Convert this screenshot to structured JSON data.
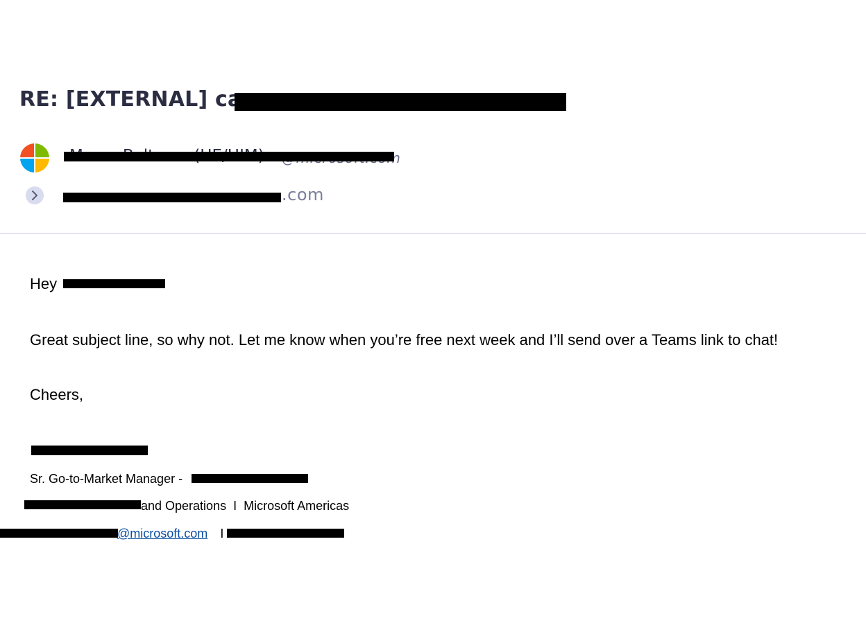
{
  "email": {
    "subject": "RE: [EXTERNAL] can",
    "sender_name": "Marco Baltazar (HE/HIM)",
    "sender_email_domain": "@microsoft.com",
    "recipient_domain": ".com"
  },
  "body": {
    "greeting": "Hey",
    "paragraph": "Great subject line, so why not. Let me know when you’re free next week and I’ll send over a Teams link to chat!",
    "closing": "Cheers,"
  },
  "signature": {
    "title_prefix": "Sr. Go-to-Market Manager -",
    "department_suffix": "and Operations  I  Microsoft Americas",
    "email_domain": "@microsoft.com",
    "separator": "I"
  },
  "icons": {
    "avatar": "microsoft-logo-icon",
    "expand": "chevron-right-icon"
  },
  "colors": {
    "subject_text": "#2b2d42",
    "meta_text": "#6b6f8a",
    "signature_name": "#4472c4",
    "link": "#0b4ea2",
    "divider": "#e3e4f2",
    "logo_red": "#f25022",
    "logo_green": "#7fba00",
    "logo_blue": "#00a4ef",
    "logo_yellow": "#ffb900"
  }
}
